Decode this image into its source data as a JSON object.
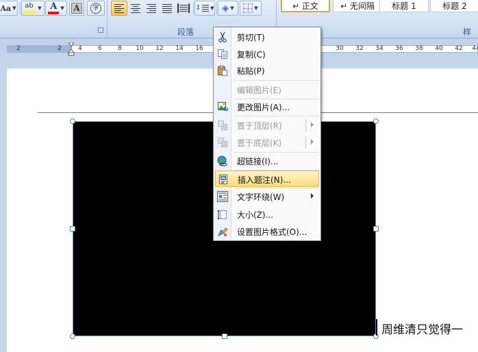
{
  "ribbon": {
    "font_group": {
      "font_size_button": "Aa",
      "highlight_glyph": "ab",
      "font_color_glyph": "A",
      "char_shading_glyph": "A"
    },
    "paragraph_group": {
      "label": "段落"
    },
    "styles_group": {
      "label": "样式",
      "styles": [
        "↵ 正文",
        "↵ 无间隔",
        "标题 1",
        "标题 2"
      ]
    },
    "colors": {
      "highlight": "#ffff00",
      "font_color": "#ff0000",
      "active_align": "#ffc35a"
    }
  },
  "ruler": {
    "labels": [
      "2",
      "2",
      "4",
      "6",
      "8",
      "10",
      "12",
      "14",
      "16",
      "30",
      "32",
      "34",
      "36",
      "38",
      "40",
      "42",
      "44"
    ]
  },
  "document": {
    "text": "周维清只觉得一"
  },
  "context_menu": {
    "items": [
      {
        "label": "剪切(T)",
        "icon": "scissors-icon",
        "enabled": true
      },
      {
        "label": "复制(C)",
        "icon": "copy-icon",
        "enabled": true
      },
      {
        "label": "粘贴(P)",
        "icon": "paste-icon",
        "enabled": true
      },
      {
        "label": "编辑图片(E)",
        "icon": "",
        "enabled": false
      },
      {
        "label": "更改图片(A)...",
        "icon": "change-picture-icon",
        "enabled": true
      },
      {
        "label": "置于顶层(R)",
        "icon": "bring-to-front-icon",
        "enabled": false,
        "submenu": true
      },
      {
        "label": "置于底层(K)",
        "icon": "send-to-back-icon",
        "enabled": false,
        "submenu": true
      },
      {
        "label": "超链接(I)...",
        "icon": "hyperlink-globe-icon",
        "enabled": true
      },
      {
        "label": "插入题注(N)...",
        "icon": "insert-caption-icon",
        "enabled": true,
        "highlighted": true
      },
      {
        "label": "文字环绕(W)",
        "icon": "text-wrap-icon",
        "enabled": true,
        "submenu": true
      },
      {
        "label": "大小(Z)...",
        "icon": "size-icon",
        "enabled": true
      },
      {
        "label": "设置图片格式(O)...",
        "icon": "format-picture-icon",
        "enabled": true
      }
    ]
  }
}
